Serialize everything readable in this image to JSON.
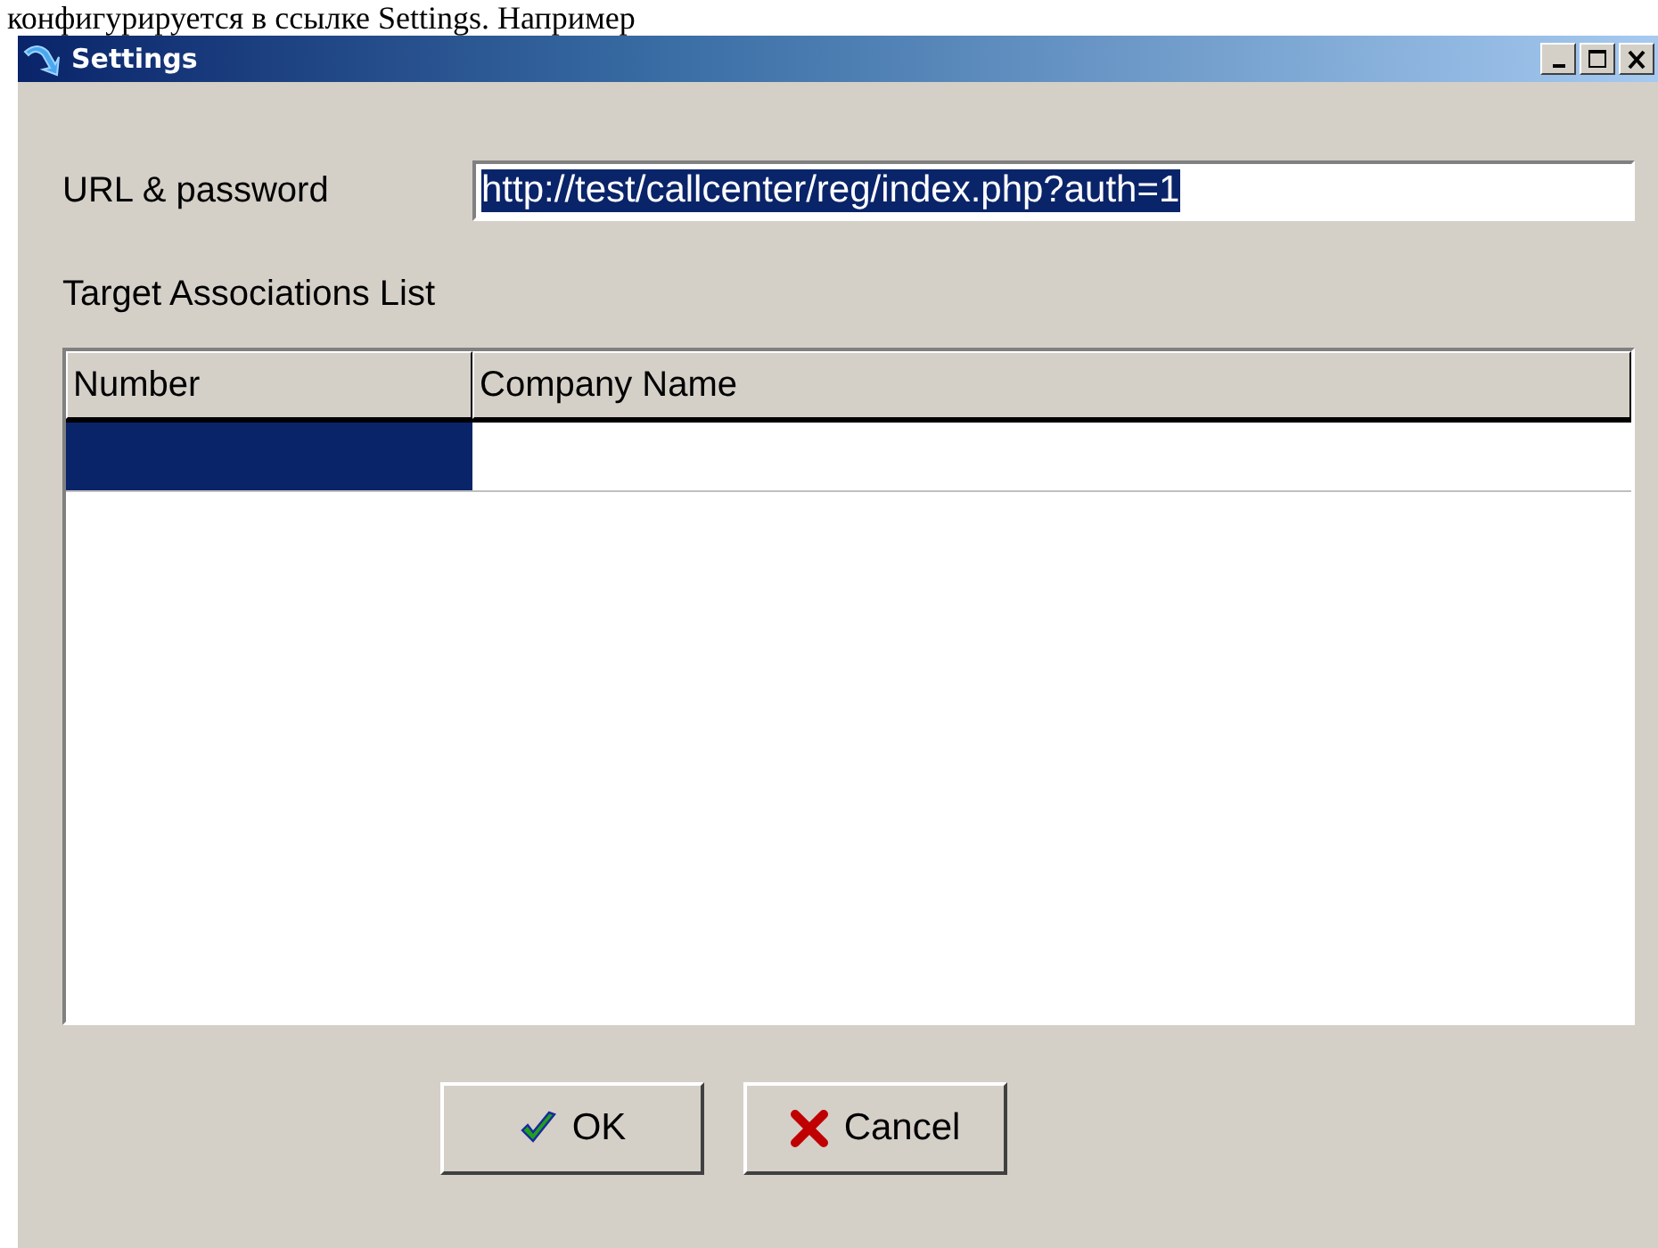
{
  "page_text": "конфигурируется в ссылке Settings. Например",
  "window": {
    "title": "Settings",
    "controls": [
      {
        "kind": "minimize"
      },
      {
        "kind": "maximize"
      },
      {
        "kind": "close"
      }
    ]
  },
  "url_field": {
    "label": "URL & password",
    "value": "http://test/callcenter/reg/index.php?auth=1",
    "selected": true
  },
  "table": {
    "title": "Target Associations List",
    "columns": [
      "Number",
      "Company Name"
    ],
    "rows": [
      {
        "selected": true
      }
    ]
  },
  "buttons": [
    {
      "kind": "ok",
      "label": "OK"
    },
    {
      "kind": "cancel",
      "label": "Cancel"
    }
  ]
}
